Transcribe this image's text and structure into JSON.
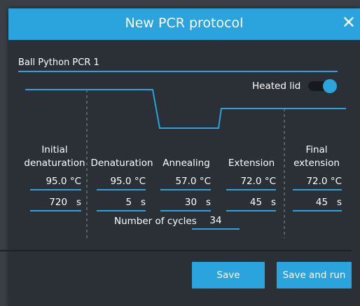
{
  "dialog": {
    "title": "New PCR protocol",
    "close_label": "✕"
  },
  "protocol": {
    "name_value": "Ball Python PCR 1"
  },
  "heated_lid": {
    "label": "Heated lid",
    "enabled": true
  },
  "steps": [
    {
      "label_line1": "Initial",
      "label_line2": "denaturation",
      "temperature": "95.0",
      "temp_unit": "°C",
      "time": "720",
      "time_unit": "s"
    },
    {
      "label_line1": "",
      "label_line2": "Denaturation",
      "temperature": "95.0",
      "temp_unit": "°C",
      "time": "5",
      "time_unit": "s"
    },
    {
      "label_line1": "",
      "label_line2": "Annealing",
      "temperature": "57.0",
      "temp_unit": "°C",
      "time": "30",
      "time_unit": "s"
    },
    {
      "label_line1": "",
      "label_line2": "Extension",
      "temperature": "72.0",
      "temp_unit": "°C",
      "time": "45",
      "time_unit": "s"
    },
    {
      "label_line1": "Final",
      "label_line2": "extension",
      "temperature": "72.0",
      "temp_unit": "°C",
      "time": "45",
      "time_unit": "s"
    }
  ],
  "cycles": {
    "label": "Number of cycles",
    "value": "34"
  },
  "buttons": {
    "save_label": "Save",
    "save_and_run_label": "Save and run"
  },
  "colors": {
    "accent": "#2ba3dc",
    "background": "#2b3037",
    "text": "#ffffff"
  }
}
